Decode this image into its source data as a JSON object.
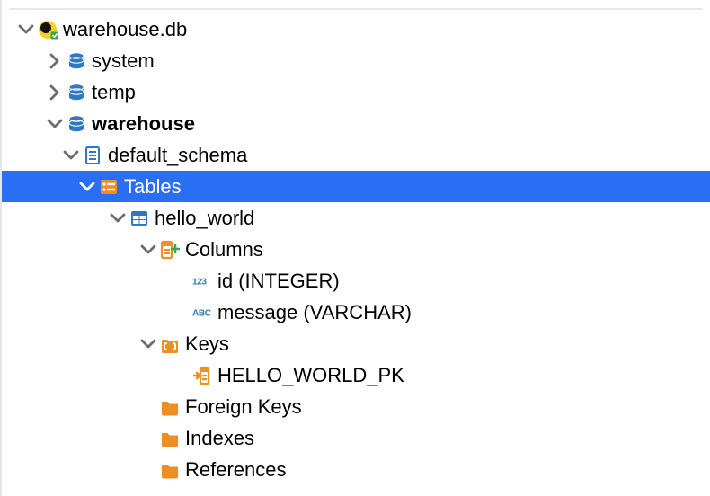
{
  "tree": {
    "root": {
      "label": "warehouse.db",
      "children": {
        "system": {
          "label": "system"
        },
        "temp": {
          "label": "temp"
        },
        "warehouse": {
          "label": "warehouse",
          "schema": {
            "label": "default_schema",
            "tables_node": {
              "label": "Tables",
              "tables": {
                "hello_world": {
                  "label": "hello_world",
                  "columns_node": {
                    "label": "Columns",
                    "columns": [
                      {
                        "label": "id (INTEGER)"
                      },
                      {
                        "label": "message (VARCHAR)"
                      }
                    ]
                  },
                  "keys_node": {
                    "label": "Keys",
                    "keys": [
                      {
                        "label": "HELLO_WORLD_PK"
                      }
                    ]
                  },
                  "foreign_keys_node": {
                    "label": "Foreign Keys"
                  },
                  "indexes_node": {
                    "label": "Indexes"
                  },
                  "references_node": {
                    "label": "References"
                  }
                }
              }
            }
          }
        }
      }
    }
  },
  "icons": {
    "num_badge": "123",
    "abc_badge": "ABC"
  }
}
